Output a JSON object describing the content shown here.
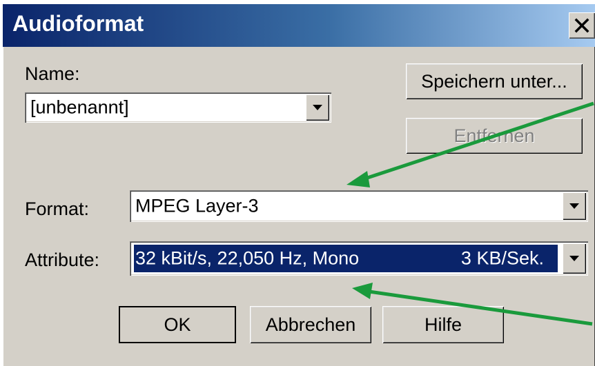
{
  "window": {
    "title": "Audioformat",
    "close_label": "X"
  },
  "name": {
    "label": "Name:",
    "value": "[unbenannt]"
  },
  "buttons": {
    "save_as": "Speichern unter...",
    "remove": "Entfernen",
    "ok": "OK",
    "cancel": "Abbrechen",
    "help": "Hilfe"
  },
  "format": {
    "label": "Format:",
    "value": "MPEG Layer-3"
  },
  "attribute": {
    "label": "Attribute:",
    "value": "32 kBit/s, 22,050 Hz, Mono",
    "rate": "3 KB/Sek."
  },
  "icons": {
    "close": "close-icon",
    "dropdown": "chevron-down-icon",
    "annotation_arrow": "arrow-icon"
  },
  "colors": {
    "title_start": "#0a246a",
    "title_end": "#a6caf0",
    "selection": "#0a246a",
    "dialog_bg": "#d4d0c8",
    "annotation_arrow": "#1a9a3c"
  }
}
